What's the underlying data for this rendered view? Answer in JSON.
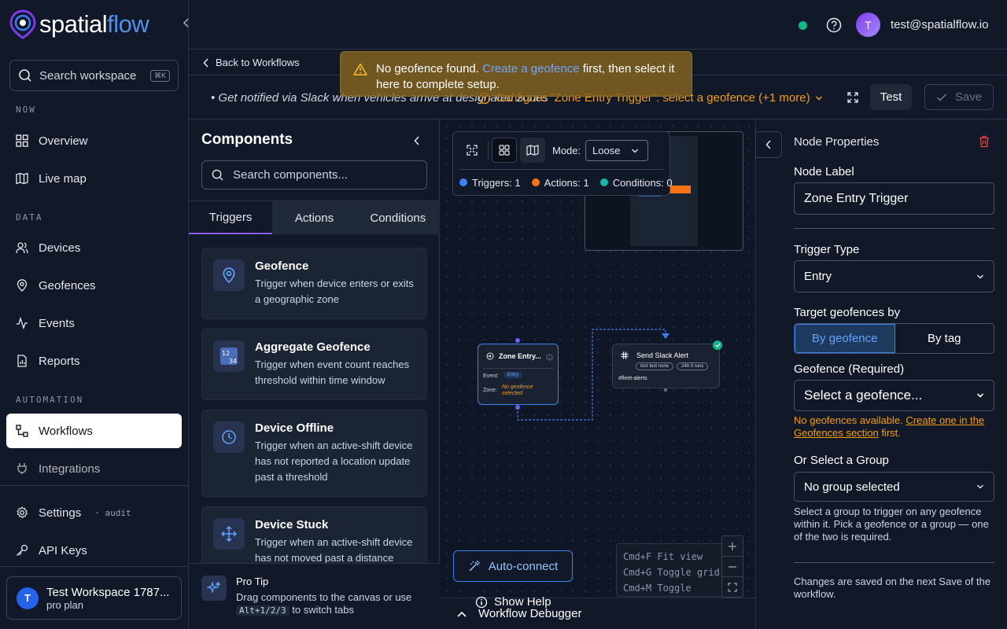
{
  "brand": {
    "logo_part1": "spatial",
    "logo_part2": "flow"
  },
  "sidebar": {
    "search_placeholder": "Search workspace",
    "search_kbd": "⌘K",
    "sections": {
      "now": "NOW",
      "data": "DATA",
      "automation": "AUTOMATION"
    },
    "items": {
      "overview": "Overview",
      "live_map": "Live map",
      "devices": "Devices",
      "geofences": "Geofences",
      "events": "Events",
      "reports": "Reports",
      "workflows": "Workflows",
      "integrations": "Integrations",
      "settings": "Settings",
      "settings_tag": "· audit",
      "api_keys": "API Keys"
    },
    "workspace": {
      "avatar": "T",
      "name": "Test Workspace 1787...",
      "plan": "pro plan"
    }
  },
  "topbar": {
    "user_avatar": "T",
    "user_email": "test@spatialflow.io"
  },
  "toast": {
    "text_before": "No geofence found.",
    "link": "Create a geofence",
    "text_after": "first, then select it here to complete setup."
  },
  "workflow": {
    "back": "Back to Workflows",
    "description": "Get notified via Slack when vehicles arrive at designated zones",
    "setup_warning": "Configure \"Zone Entry Trigger\": select a geofence (+1 more)",
    "test_label": "Test",
    "save_label": "Save"
  },
  "components": {
    "title": "Components",
    "search_placeholder": "Search components...",
    "tabs": [
      "Triggers",
      "Actions",
      "Conditions"
    ],
    "cards": [
      {
        "title": "Geofence",
        "desc": "Trigger when device enters or exits a geographic zone"
      },
      {
        "title": "Aggregate Geofence",
        "desc": "Trigger when event count reaches threshold within time window"
      },
      {
        "title": "Device Offline",
        "desc": "Trigger when an active-shift device has not reported a location update past a threshold"
      },
      {
        "title": "Device Stuck",
        "desc": "Trigger when an active-shift device has not moved past a distance"
      }
    ],
    "pro_tip": {
      "title": "Pro Tip",
      "desc": "Drag components to the canvas or use",
      "keys": "Alt+1/2/3",
      "desc2": "to switch tabs"
    }
  },
  "canvas": {
    "mode_label": "Mode:",
    "mode_value": "Loose",
    "counts": {
      "triggers": "Triggers: 1",
      "actions": "Actions: 1",
      "conditions": "Conditions: 0"
    },
    "colors": {
      "triggers": "#3b82f6",
      "actions": "#f97316",
      "conditions": "#14b8a6"
    },
    "node_trigger": {
      "title": "Zone Entry...",
      "event_label": "Event:",
      "event_value": "Entry",
      "zone_label": "Zone:",
      "zone_value": "No geofence selected"
    },
    "node_action": {
      "title": "Send Slack Alert",
      "pill1": "test test none",
      "pill2": "24h 0 runs",
      "channel": "#fleet-alerts"
    },
    "auto_connect": "Auto-connect",
    "shortcuts": [
      "Cmd+F Fit view",
      "Cmd+G Toggle grid",
      "Cmd+M Toggle minimap"
    ],
    "show_help": "Show Help",
    "debugger": "Workflow Debugger"
  },
  "properties": {
    "title": "Node Properties",
    "node_label_label": "Node Label",
    "node_label_value": "Zone Entry Trigger",
    "trigger_type_label": "Trigger Type",
    "trigger_type_value": "Entry",
    "target_label": "Target geofences by",
    "target_options": [
      "By geofence",
      "By tag"
    ],
    "geofence_label": "Geofence (Required)",
    "geofence_value": "Select a geofence...",
    "geofence_warn_before": "No geofences available.",
    "geofence_warn_link": "Create one in the Geofences section",
    "geofence_warn_after": "first.",
    "group_label": "Or Select a Group",
    "group_value": "No group selected",
    "group_note": "Select a group to trigger on any geofence within it. Pick a geofence or a group — one of the two is required.",
    "save_note": "Changes are saved on the next Save of the workflow."
  }
}
